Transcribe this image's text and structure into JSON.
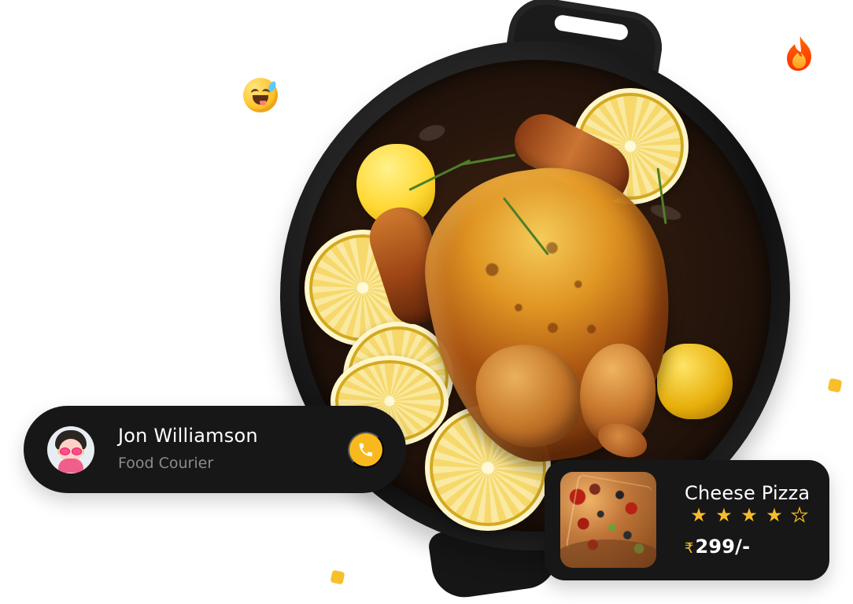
{
  "courier": {
    "name": "Jon Williamson",
    "role": "Food Courier"
  },
  "pizza": {
    "title": "Cheese Pizza",
    "rating": 4,
    "max_rating": 5,
    "price_symbol": "₹",
    "price_value": "299/-"
  },
  "icons": {
    "call": "phone-icon",
    "emoji": "laughing-emoji-icon",
    "fire": "fire-icon",
    "rating_star": "star-icon"
  },
  "colors": {
    "card_bg": "#171717",
    "accent": "#f9b91e",
    "secondary_text": "#8b8b8b",
    "white": "#ffffff"
  }
}
